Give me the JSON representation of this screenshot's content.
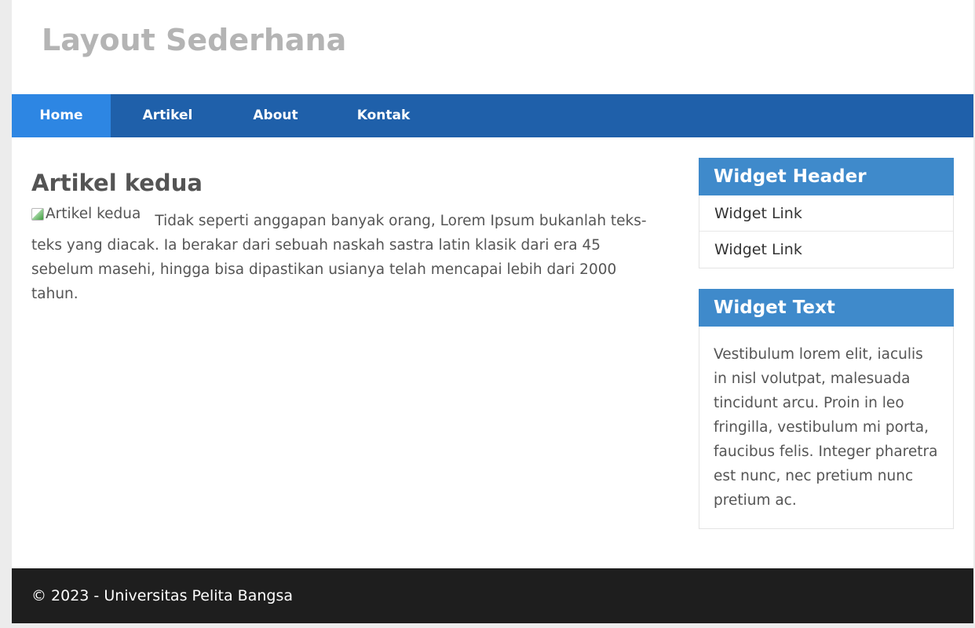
{
  "header": {
    "site_title": "Layout Sederhana"
  },
  "nav": {
    "items": [
      {
        "label": "Home",
        "active": true
      },
      {
        "label": "Artikel",
        "active": false
      },
      {
        "label": "About",
        "active": false
      },
      {
        "label": "Kontak",
        "active": false
      }
    ]
  },
  "article": {
    "title": "Artikel kedua",
    "image_alt": "Artikel kedua",
    "body": "Tidak seperti anggapan banyak orang, Lorem Ipsum bukanlah teks-teks yang diacak. Ia berakar dari sebuah naskah sastra latin klasik dari era 45 sebelum masehi, hingga bisa dipastikan usianya telah mencapai lebih dari 2000 tahun."
  },
  "sidebar": {
    "links_widget": {
      "header": "Widget Header",
      "links": [
        "Widget Link",
        "Widget Link"
      ]
    },
    "text_widget": {
      "header": "Widget Text",
      "text": "Vestibulum lorem elit, iaculis in nisl volutpat, malesuada tincidunt arcu. Proin in leo fringilla, vestibulum mi porta, faucibus felis. Integer pharetra est nunc, nec pretium nunc pretium ac."
    }
  },
  "footer": {
    "text": "© 2023 - Universitas Pelita Bangsa"
  },
  "colors": {
    "nav_background": "#1f60aa",
    "nav_active": "#2d86e3",
    "widget_header": "#3f8acb",
    "footer_background": "#1e1e1e",
    "site_title": "#b4b4b4"
  }
}
